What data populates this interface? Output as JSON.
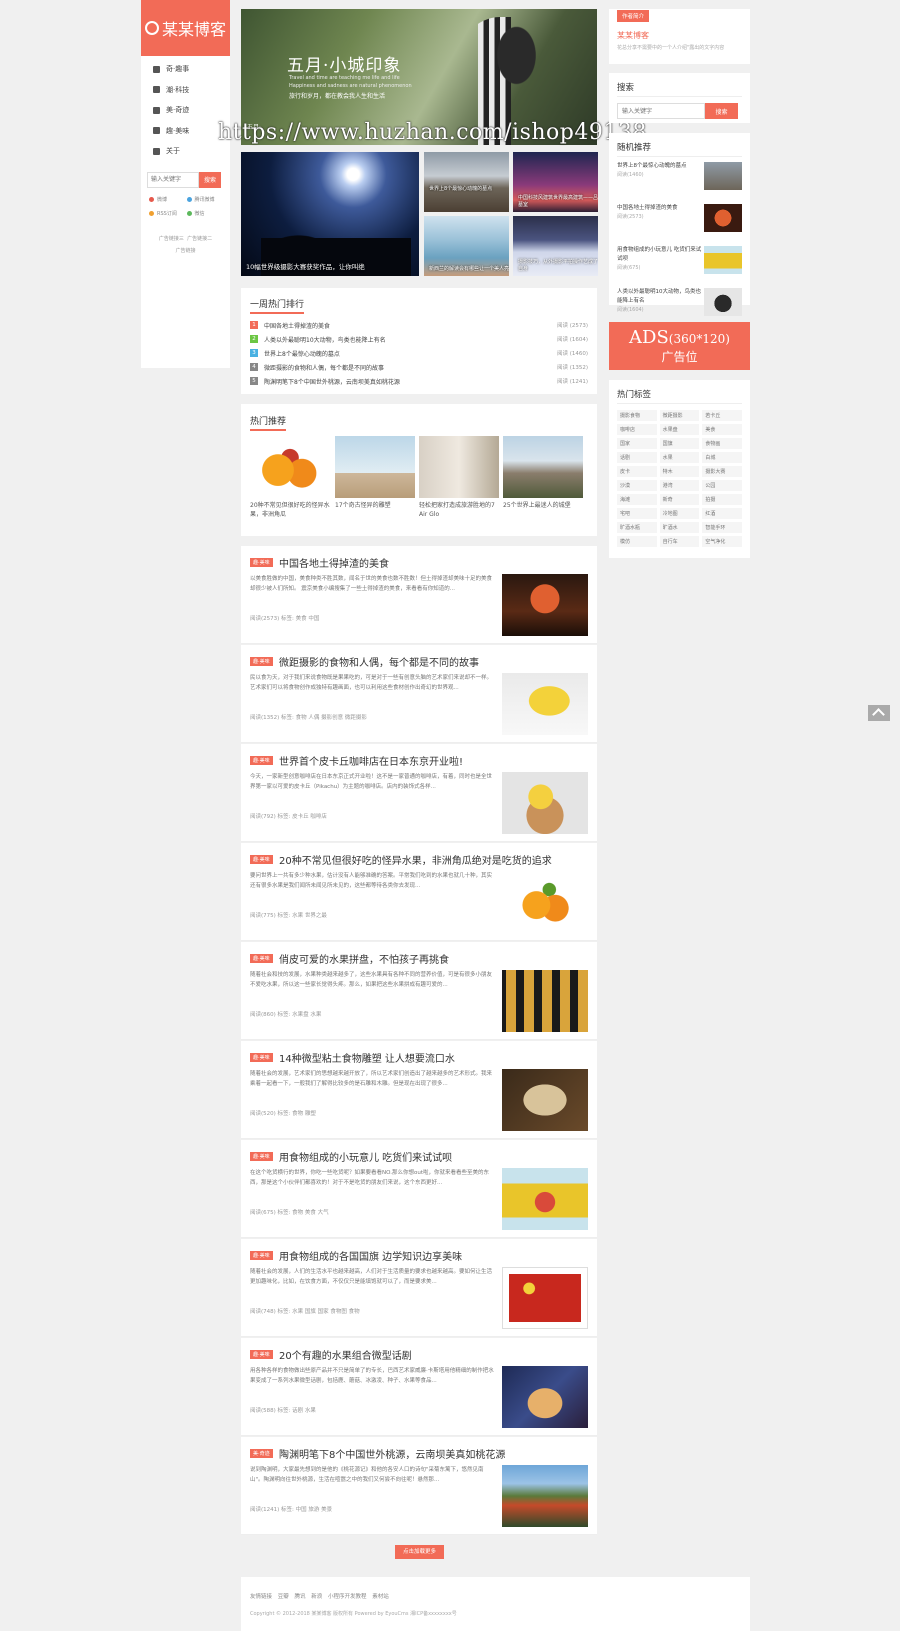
{
  "logo": {
    "text": "某某博客"
  },
  "nav": [
    {
      "label": "奇·趣事"
    },
    {
      "label": "潮·科技"
    },
    {
      "label": "美·奇迹"
    },
    {
      "label": "趣·美味"
    },
    {
      "label": "关于"
    }
  ],
  "left_search": {
    "placeholder": "输入关键字",
    "button": "搜索"
  },
  "sns": [
    {
      "label": "微博",
      "color": "#e6594c"
    },
    {
      "label": "腾讯微博",
      "color": "#4aa3df"
    },
    {
      "label": "RSS订阅",
      "color": "#f0a030"
    },
    {
      "label": "微信",
      "color": "#5cb85c"
    }
  ],
  "ad_links": [
    "广告链接三",
    "广告链接二",
    "广告链接"
  ],
  "banner": {
    "title": "五月·小城印象",
    "line1": "Travel and time are teaching me life and life",
    "line2": "Happiness and sadness are natural phenomenon",
    "line3": "旅行和岁月，都在教会我人生和生活",
    "caption": "五月·"
  },
  "slides": [
    {
      "caption": "10幅世界级摄影大赛获奖作品，让你叫绝"
    },
    {
      "caption": "世界上8个最惊心动魄的墓点"
    },
    {
      "caption": "中国科技风建筑世界最高建筑——吕墓室"
    },
    {
      "caption": "新西兰的解读会有哪些让一个美人亮"
    },
    {
      "caption": "摄影技巧，从外摄影平拍操作艺成了自身"
    }
  ],
  "hot_week": {
    "title": "一周热门排行",
    "items": [
      {
        "num": "1",
        "title": "中国各地土得掉渣的美食",
        "reads": "阅读 (2573)",
        "color": "#f26b57"
      },
      {
        "num": "2",
        "title": "人类以外最聪明10大动物，鸟类也能降上有名",
        "reads": "阅读 (1604)",
        "color": "#6cc644"
      },
      {
        "num": "3",
        "title": "世界上8个最惊心动魄的墓点",
        "reads": "阅读 (1460)",
        "color": "#49b1e2"
      },
      {
        "num": "4",
        "title": "微距摄影的食物和人偶，每个都是不同的故事",
        "reads": "阅读 (1352)",
        "color": "#888888"
      },
      {
        "num": "5",
        "title": "陶渊明笔下8个中国世外桃源，云南坝美真如桃花源",
        "reads": "阅读 (1241)",
        "color": "#888888"
      }
    ]
  },
  "hot_rec": {
    "title": "热门推荐",
    "items": [
      {
        "caption": "20种不常见但很好吃的怪异水果，非洲角瓜"
      },
      {
        "caption": "17个奇古怪异的雕塑"
      },
      {
        "caption": "轻松把家打造成旅游胜地的7 Air Glo"
      },
      {
        "caption": "25个世界上最迷人的城堡"
      }
    ]
  },
  "posts": [
    {
      "cat": "趣·美味",
      "title": "中国各地土得掉渣的美食",
      "excerpt": "以美食胜做的中国，美食种类不胜其数，闻名于世的美食也数不胜数！但土得掉渣却美味十足的美食却很少被人们所知。 震京美食小编搜集了一些土得掉渣的美食，来看看有你知道的...",
      "meta": "阅读(2573)   标签: 美食 中国"
    },
    {
      "cat": "趣·美味",
      "title": "微距摄影的食物和人偶，每个都是不同的故事",
      "excerpt": "民以食为天，对于我们来说食物既是果果吃的，可是对于一些有创意头脑的艺术家们来说却不一样。艺术家们可以将食物创作成独特有趣画面，也可以利用这些食材创作出奇幻的世界观...",
      "meta": "阅读(1352)   标签: 食物 人偶 摄影创意 微距摄影"
    },
    {
      "cat": "趣·美味",
      "title": "世界首个皮卡丘咖啡店在日本东京开业啦!",
      "excerpt": "今天，一家新型创意咖啡店在日本东京正式开业啦！这不是一家普通的咖啡店，有着，同时也是全世界第一家以可爱的皮卡丘（Pikachu）为主题的咖啡店。店内的装饰式各样...",
      "meta": "阅读(792)   标签: 皮卡丘 咖啡店"
    },
    {
      "cat": "趣·美味",
      "title": "20种不常见但很好吃的怪异水果，非洲角瓜绝对是吃货的追求",
      "excerpt": "要问世界上一共有多少种水果，估计没有人能够准确的答案。平常我们吃到的水果也就几十种，其实还有很多水果是我们闻所未闻见所未见的，这些都等待各类你去发现...",
      "meta": "阅读(775)   标签: 水果 世界之最"
    },
    {
      "cat": "趣·美味",
      "title": "俏皮可爱的水果拼盘，不怕孩子再挑食",
      "excerpt": "随着社会和技的发展，水果种类越来越多了，这些水果具有各种不同的营养价值，可是有很多小朋友不爱吃水果，所以这一些家长觉得头疼。那么，如果把这些水果拼成有趣可爱的...",
      "meta": "阅读(860)   标签: 水果盘 水果"
    },
    {
      "cat": "趣·美味",
      "title": "14种微型粘土食物雕塑 让人想要流口水",
      "excerpt": "随着社会的发展，艺术家们的思想越来越开放了，所以艺术家们创造出了越来越多的艺术形式。我来乘着一起看一下，一般我们了解得比较多的是石雕和木雕。但是现在出现了很多...",
      "meta": "阅读(520)   标签: 食物 雕塑"
    },
    {
      "cat": "趣·美味",
      "title": "用食物组成的小玩意儿 吃货们来试试呗",
      "excerpt": "在这个吃货横行的世界，你吃一些吃货呢？如果要看看NO.那么你想out啦，你就来看看些至美的东西，那是这个小伙伴们都喜欢的！对于不是吃货的朋友们来说，这个东西更好...",
      "meta": "阅读(675)   标签: 食物 美食 大气"
    },
    {
      "cat": "趣·美味",
      "title": "用食物组成的各国国旗 边学知识边享美味",
      "excerpt": "随着社会的发展，人们的生活水平也越来越高，人们对于生活质量的要求也越来越高。要如何让生活更加趣味化，比如，在饮食方面，不仅仅只是能填饱就可以了，而是要求美...",
      "meta": "阅读(748)   标签: 水果 国旗 国家 食物图 食物"
    },
    {
      "cat": "趣·美味",
      "title": "20个有趣的水果组合微型话剧",
      "excerpt": "用各种各样的食物做出些原产品并不只是简单了的专长，巴西艺术家威廉·卡斯塔用他精细的制作把水果变成了一系列水果微型话剧，包括鹿、蘑菇、冰激凌、种子、水果等食品...",
      "meta": "阅读(588)   标签: 话剧 水果"
    },
    {
      "cat": "美·奇迹",
      "title": "陶渊明笔下8个中国世外桃源，云南坝美真如桃花源",
      "excerpt": "说到陶渊明，大家最先想到的是他的《桃花源记》和他的各安人口的诗句\"采菊东篱下，悠然见南山\"。陶渊明向往世外桃源，生活在喧嚣之中的我们又何尝不向往呢！悬然那...",
      "meta": "阅读(1241)   标签: 中国 旅游 美景"
    }
  ],
  "more_button": "点击加载更多",
  "author": {
    "badge": "作者简介",
    "name": "某某博客",
    "desc": "花总分享不需要中的一个人介绍\"露出的文字内容"
  },
  "right_search": {
    "title": "搜索",
    "placeholder": "输入关键字",
    "button": "搜索"
  },
  "random": {
    "title": "随机推荐",
    "items": [
      {
        "title": "世界上8个最惊心动魄的墓点",
        "reads": "阅读(1460)"
      },
      {
        "title": "中国各地土得掉渣的美食",
        "reads": "阅读(2573)"
      },
      {
        "title": "用食物组成的小玩意儿 吃货们来试试呗",
        "reads": "阅读(675)"
      },
      {
        "title": "人类以外最聪明10大动物，鸟类也能降上有名",
        "reads": "阅读(1604)"
      }
    ]
  },
  "ad": {
    "line1": "ADS",
    "size": "(360*120)",
    "line2": "广告位"
  },
  "tags": {
    "title": "热门标签",
    "items": [
      "摄影食物",
      "微距摄影",
      "若卡丘",
      "咖啡店",
      "水果盘",
      "美食",
      "国家",
      "国旗",
      "食物画",
      "话剧",
      "水果",
      "白城",
      "皮卡",
      "特木",
      "摄影大赛",
      "沙漠",
      "港湾",
      "公园",
      "海滩",
      "新奇",
      "拍摄",
      "宅吧",
      "冷地图",
      "红酒",
      "旷酒水瓶",
      "旷酒水",
      "智能手环",
      "模仿",
      "自行车",
      "空气净化"
    ]
  },
  "footer": {
    "links": "友情链接  豆瓣  腾讯  新浪  小程序开发教程  素材站",
    "copy": "Copyright © 2012-2018 某某博客 版权所有 Powered by EyouCms 湘ICP备xxxxxxxx号"
  },
  "watermark": "https://www.huzhan.com/ishop49138"
}
